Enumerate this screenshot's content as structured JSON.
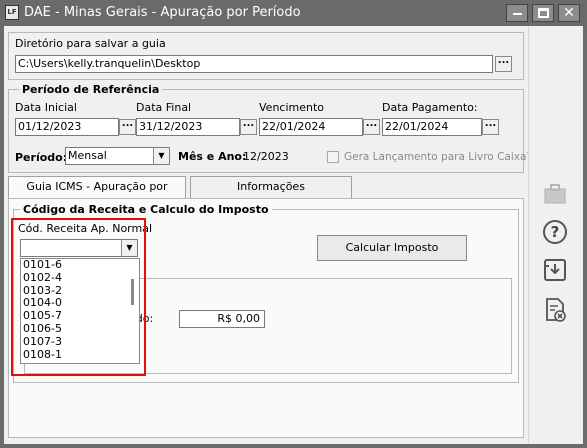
{
  "titlebar": {
    "app_icon_text": "LF",
    "title": "DAE - Minas Gerais - Apuração por Período"
  },
  "window_controls": [
    "minimize-icon",
    "maximize-icon",
    "close-icon"
  ],
  "directory": {
    "label": "Diretório para salvar a guia",
    "path": "C:\\Users\\kelly.tranquelin\\Desktop",
    "browse_label": "..."
  },
  "reference_period": {
    "title": "Período de Referência",
    "data_inicial_label": "Data Inicial",
    "data_inicial_value": "01/12/2023",
    "data_final_label": "Data Final",
    "data_final_value": "31/12/2023",
    "vencimento_label": "Vencimento",
    "vencimento_value": "22/01/2024",
    "data_pagamento_label": "Data Pagamento:",
    "data_pagamento_value": "22/01/2024",
    "periodo_label": "Período:",
    "periodo_value": "Mensal",
    "mes_ano_label": "Mês e Ano:",
    "mes_ano_value": "12/2023",
    "gera_lancamento_label": "Gera Lançamento para Livro Caixa?",
    "gera_lancamento_checked": false,
    "ellipsis": "..."
  },
  "tabs": [
    {
      "label": "Guia ICMS - Apuração por Período",
      "active": true
    },
    {
      "label": "Informações Complementares",
      "active": false
    }
  ],
  "receita": {
    "group_title": "Código da Receita e Calculo do Imposto",
    "cod_receita_label": "Cód. Receita Ap. Normal",
    "cod_receita_value": "",
    "calcular_button": "Calcular Imposto",
    "partial_label": "odo:",
    "valor": "R$ 0,00",
    "dropdown_options": [
      "0101-6",
      "0102-4",
      "0103-2",
      "0104-0",
      "0105-7",
      "0106-5",
      "0107-3",
      "0108-1"
    ]
  },
  "side_toolbar": [
    "briefcase-icon",
    "help-icon",
    "save-icon",
    "delete-document-icon"
  ],
  "colors": {
    "titlebar": "#6a6a6a",
    "window_bg": "#f0f0f0",
    "highlight": "#e01010"
  }
}
